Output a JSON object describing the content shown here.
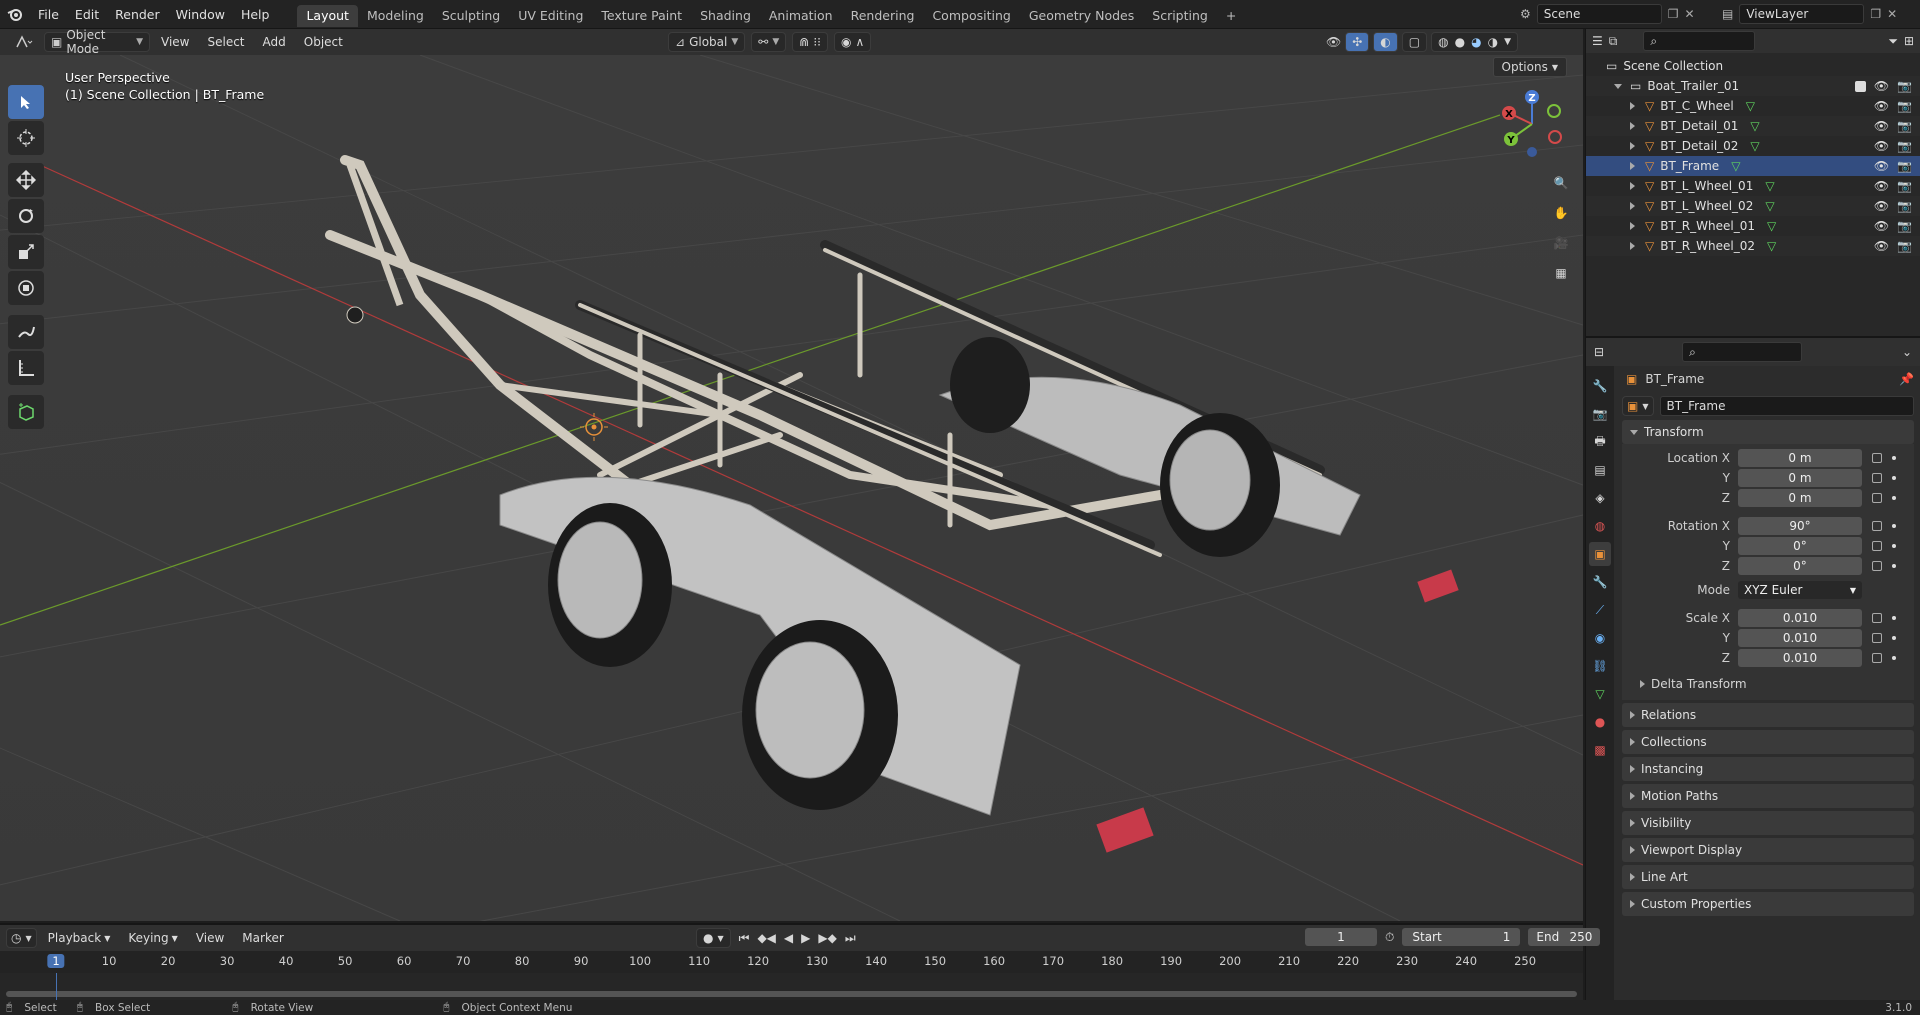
{
  "topbar": {
    "menus": [
      "File",
      "Edit",
      "Render",
      "Window",
      "Help"
    ],
    "workspaces": [
      "Layout",
      "Modeling",
      "Sculpting",
      "UV Editing",
      "Texture Paint",
      "Shading",
      "Animation",
      "Rendering",
      "Compositing",
      "Geometry Nodes",
      "Scripting"
    ],
    "active_workspace": "Layout",
    "scene": "Scene",
    "view_layer": "ViewLayer"
  },
  "viewport_header": {
    "mode": "Object Mode",
    "menus": [
      "View",
      "Select",
      "Add",
      "Object"
    ],
    "orientation": "Global",
    "options": "Options"
  },
  "viewport": {
    "perspective": "User Perspective",
    "collection_info": "(1) Scene Collection | BT_Frame",
    "gizmo_axes": {
      "x": "X",
      "y": "Y",
      "z": "Z"
    }
  },
  "outliner": {
    "root": "Scene Collection",
    "collection": "Boat_Trailer_01",
    "items": [
      "BT_C_Wheel",
      "BT_Detail_01",
      "BT_Detail_02",
      "BT_Frame",
      "BT_L_Wheel_01",
      "BT_L_Wheel_02",
      "BT_R_Wheel_01",
      "BT_R_Wheel_02"
    ],
    "selected": "BT_Frame"
  },
  "properties": {
    "object_name": "BT_Frame",
    "datablock": "BT_Frame",
    "transform_label": "Transform",
    "location": {
      "label_x": "Location X",
      "label_y": "Y",
      "label_z": "Z",
      "x": "0 m",
      "y": "0 m",
      "z": "0 m"
    },
    "rotation": {
      "label_x": "Rotation X",
      "label_y": "Y",
      "label_z": "Z",
      "x": "90°",
      "y": "0°",
      "z": "0°"
    },
    "mode": {
      "label": "Mode",
      "value": "XYZ Euler"
    },
    "scale": {
      "label_x": "Scale X",
      "label_y": "Y",
      "label_z": "Z",
      "x": "0.010",
      "y": "0.010",
      "z": "0.010"
    },
    "delta_transform": "Delta Transform",
    "panels": [
      "Relations",
      "Collections",
      "Instancing",
      "Motion Paths",
      "Visibility",
      "Viewport Display",
      "Line Art",
      "Custom Properties"
    ]
  },
  "timeline": {
    "menus": [
      "Playback",
      "Keying",
      "View",
      "Marker"
    ],
    "current_frame": "1",
    "start_label": "Start",
    "start": "1",
    "end_label": "End",
    "end": "250",
    "ticks": [
      "1",
      "10",
      "20",
      "30",
      "40",
      "50",
      "60",
      "70",
      "80",
      "90",
      "100",
      "110",
      "120",
      "130",
      "140",
      "150",
      "160",
      "170",
      "180",
      "190",
      "200",
      "210",
      "220",
      "230",
      "240",
      "250"
    ]
  },
  "statusbar": {
    "select": "Select",
    "box_select": "Box Select",
    "rotate_view": "Rotate View",
    "context_menu": "Object Context Menu",
    "version": "3.1.0"
  },
  "colors": {
    "accent": "#4772b3",
    "object_orange": "#e8913a",
    "mesh_green": "#5fd45f",
    "grid_red": "#b13b3b",
    "grid_green": "#6b9a2b"
  }
}
